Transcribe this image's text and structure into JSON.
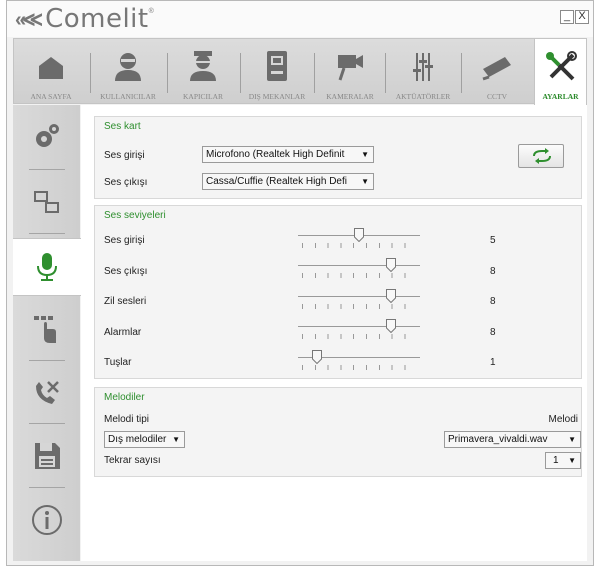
{
  "brand": {
    "name": "Comelit",
    "reg": "®"
  },
  "window": {
    "min_label": "_",
    "close_label": "X"
  },
  "topnav": [
    {
      "key": "home",
      "label": "ANA SAYFA",
      "icon": "home-icon"
    },
    {
      "key": "users",
      "label": "KULLANICILAR",
      "icon": "user-icon"
    },
    {
      "key": "doormen",
      "label": "KAPICILAR",
      "icon": "doorman-icon"
    },
    {
      "key": "outdoor",
      "label": "DIŞ MEKANLAR",
      "icon": "entrance-panel-icon"
    },
    {
      "key": "cameras",
      "label": "KAMERALAR",
      "icon": "video-camera-icon"
    },
    {
      "key": "actuators",
      "label": "AKTÜATÖRLER",
      "icon": "actuator-sliders-icon"
    },
    {
      "key": "cctv",
      "label": "CCTV",
      "icon": "cctv-camera-icon"
    },
    {
      "key": "settings",
      "label": "AYARLAR",
      "icon": "tools-icon",
      "active": true
    }
  ],
  "sidenav": [
    {
      "icon": "gears-icon"
    },
    {
      "icon": "network-computers-icon"
    },
    {
      "icon": "microphone-icon",
      "active": true
    },
    {
      "icon": "touch-keypad-icon"
    },
    {
      "icon": "phone-tools-icon"
    },
    {
      "icon": "save-icon"
    },
    {
      "icon": "info-icon"
    }
  ],
  "sound_card": {
    "title": "Ses kart",
    "input_label": "Ses girişi",
    "input_value": "Microfono (Realtek High Definit",
    "output_label": "Ses çıkışı",
    "output_value": "Cassa/Cuffie (Realtek High Defi"
  },
  "levels": {
    "title": "Ses seviyeleri",
    "max": 10,
    "items": [
      {
        "label": "Ses girişi",
        "value": "5"
      },
      {
        "label": "Ses çıkışı",
        "value": "8"
      },
      {
        "label": "Zil sesleri",
        "value": "8"
      },
      {
        "label": "Alarmlar",
        "value": "8"
      },
      {
        "label": "Tuşlar",
        "value": "1"
      }
    ]
  },
  "melodies": {
    "title": "Melodiler",
    "type_label": "Melodi tipi",
    "melody_label": "Melodi",
    "type_value": "Dış melodiler",
    "melody_value": "Primavera_vivaldi.wav",
    "repeat_label": "Tekrar sayısı",
    "repeat_value": "1"
  },
  "colors": {
    "accent": "#2f8f2f",
    "icon_gray": "#6b6b6b",
    "nav_bg": "#d6d6d6"
  }
}
